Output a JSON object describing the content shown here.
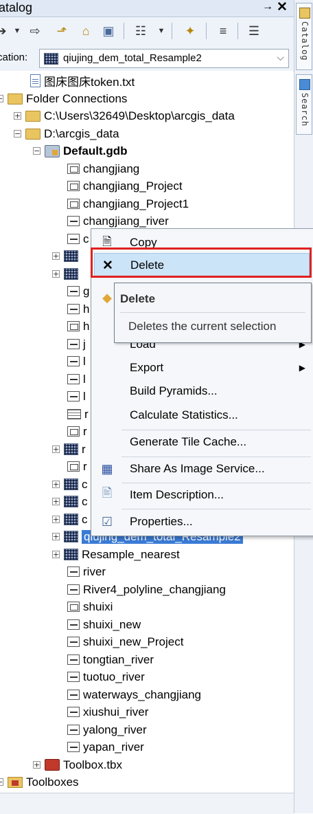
{
  "window": {
    "title": "atalog",
    "pin_label": "↓←",
    "close_label": "✕"
  },
  "toolbar": {
    "buttons": [
      "back-arrow",
      "dropdown",
      "forward-arrow",
      "up-folder",
      "home",
      "connect",
      "view-options",
      "dropdown",
      "new-item",
      "tree-toggle",
      "details"
    ]
  },
  "location": {
    "label": "cation:",
    "value": "qiujing_dem_total_Resample2"
  },
  "side_tabs": {
    "catalog": "Catalog",
    "search": "Search"
  },
  "tree": {
    "txt_file": "图床图床token.txt",
    "folder_connections": "Folder Connections",
    "folder1": "C:\\Users\\32649\\Desktop\\arcgis_data",
    "folder2": "D:\\arcgis_data",
    "gdb": "Default.gdb",
    "items": [
      {
        "label": "changjiang",
        "icon": "polygon"
      },
      {
        "label": "changjiang_Project",
        "icon": "polygon"
      },
      {
        "label": "changjiang_Project1",
        "icon": "polygon"
      },
      {
        "label": "changjiang_river",
        "icon": "line"
      },
      {
        "label": "c",
        "icon": "line"
      },
      {
        "label": "",
        "icon": "raster"
      },
      {
        "label": "",
        "icon": "raster"
      },
      {
        "label": "g",
        "icon": "line"
      },
      {
        "label": "h",
        "icon": "line"
      },
      {
        "label": "h",
        "icon": "polygon"
      },
      {
        "label": "j",
        "icon": "line"
      },
      {
        "label": "l",
        "icon": "line"
      },
      {
        "label": "l",
        "icon": "line"
      },
      {
        "label": "l",
        "icon": "line"
      },
      {
        "label": "r",
        "icon": "table"
      },
      {
        "label": "r",
        "icon": "polygon"
      },
      {
        "label": "r",
        "icon": "raster"
      },
      {
        "label": "r",
        "icon": "polygon"
      },
      {
        "label": "c",
        "icon": "raster"
      },
      {
        "label": "c",
        "icon": "raster"
      },
      {
        "label": "c",
        "icon": "raster"
      }
    ],
    "selected": "qiujing_dem_total_Resample2",
    "after_items": [
      {
        "label": "Resample_nearest",
        "icon": "raster"
      },
      {
        "label": "river",
        "icon": "line"
      },
      {
        "label": "River4_polyline_changjiang",
        "icon": "line"
      },
      {
        "label": "shuixi",
        "icon": "polygon"
      },
      {
        "label": "shuixi_new",
        "icon": "line"
      },
      {
        "label": "shuixi_new_Project",
        "icon": "line"
      },
      {
        "label": "tongtian_river",
        "icon": "line"
      },
      {
        "label": "tuotuo_river",
        "icon": "line"
      },
      {
        "label": "waterways_changjiang",
        "icon": "line"
      },
      {
        "label": "xiushui_river",
        "icon": "line"
      },
      {
        "label": "yalong_river",
        "icon": "line"
      },
      {
        "label": "yapan_river",
        "icon": "line"
      }
    ],
    "toolbox": "Toolbox.tbx",
    "toolboxes": "Toolboxes"
  },
  "context_menu": {
    "copy": "Copy",
    "delete": "Delete",
    "load_partial": "Load",
    "export": "Export",
    "build_pyramids": "Build Pyramids...",
    "calc_stats": "Calculate Statistics...",
    "tile_cache": "Generate Tile Cache...",
    "share_image": "Share As Image Service...",
    "item_desc": "Item Description...",
    "properties": "Properties..."
  },
  "tooltip": {
    "title": "Delete",
    "description": "Deletes the current selection"
  },
  "colors": {
    "selection": "#3a7bd5",
    "highlight": "#cce4f7",
    "callout": "#e02020"
  }
}
